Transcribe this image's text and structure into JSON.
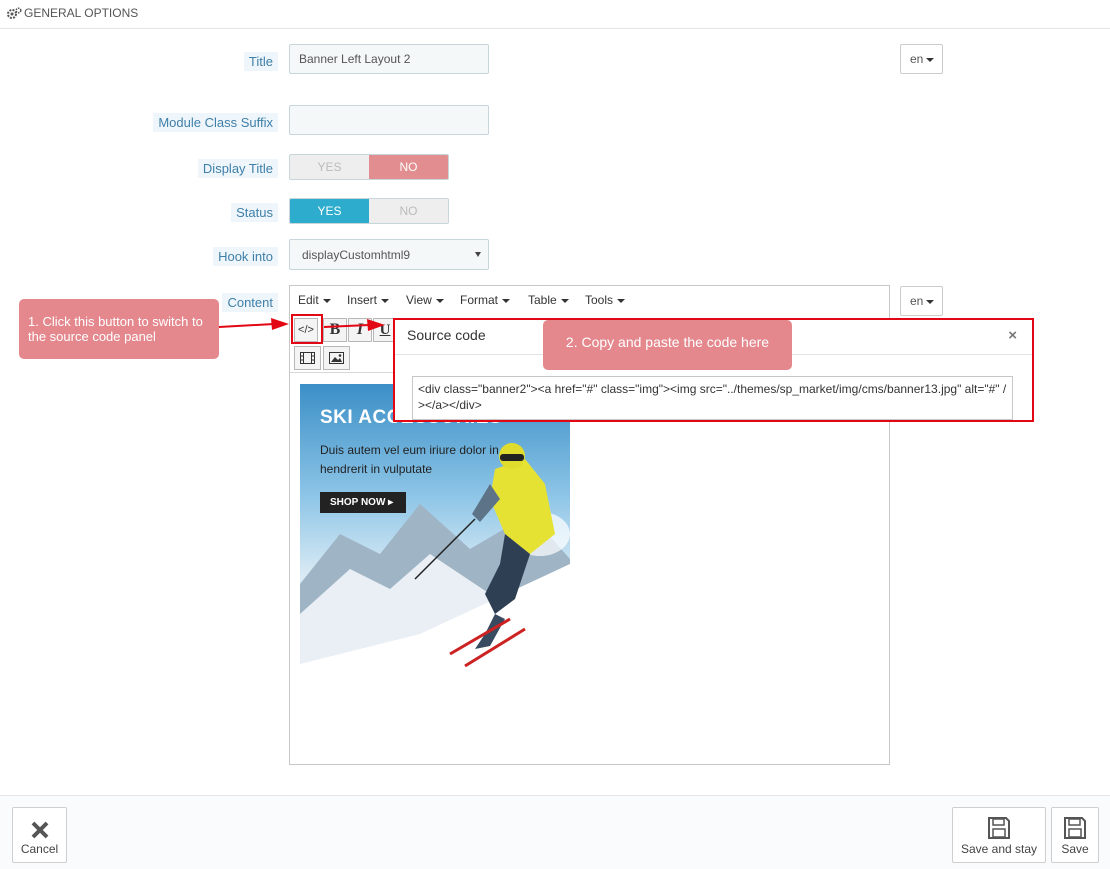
{
  "header": {
    "title": "GENERAL OPTIONS",
    "icon": "gears-icon"
  },
  "form": {
    "title_label": "Title",
    "title_value": "Banner Left Layout 2",
    "title_lang": "en",
    "suffix_label": "Module Class Suffix",
    "suffix_value": "",
    "display_title_label": "Display Title",
    "display_title_yes": "YES",
    "display_title_no": "NO",
    "display_title_selected": "NO",
    "status_label": "Status",
    "status_yes": "YES",
    "status_no": "NO",
    "status_selected": "YES",
    "hook_label": "Hook into",
    "hook_value": "displayCustomhtml9",
    "content_label": "Content",
    "content_lang": "en"
  },
  "editor": {
    "menus": [
      "Edit",
      "Insert",
      "View",
      "Format",
      "Table",
      "Tools"
    ],
    "toolbar": {
      "source_code": "</>",
      "bold": "B",
      "italic": "I",
      "underline": "U"
    }
  },
  "banner": {
    "heading": "SKI ACCESSORIES",
    "text": "Duis autem vel eum iriure dolor in hendrerit in vulputate",
    "button": "SHOP NOW"
  },
  "modal": {
    "title": "Source code",
    "close": "×",
    "code": "<div class=\"banner2\"><a href=\"#\" class=\"img\"><img src=\"../themes/sp_market/img/cms/banner13.jpg\" alt=\"#\" /></a></div>"
  },
  "callouts": {
    "step1": "1. Click this button to switch to the source code panel",
    "step2": "2. Copy and paste the code here"
  },
  "footer": {
    "cancel": "Cancel",
    "save_stay": "Save and stay",
    "save": "Save"
  },
  "colors": {
    "accent": "#2eacce",
    "no_active": "#e28d8f",
    "callout": "#e4888e",
    "highlight": "#e30613"
  }
}
